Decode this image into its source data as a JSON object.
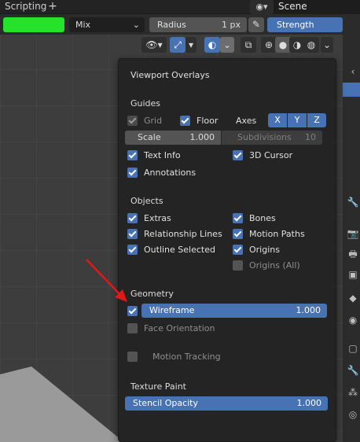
{
  "topbar": {
    "workspace_tab": "Scripting",
    "add_tab": "+",
    "scene_label": "Scene"
  },
  "toolbar": {
    "color": "#26e22a",
    "blend_mode": "Mix",
    "radius_label": "Radius",
    "radius_value": "1 px",
    "strength_label": "Strength"
  },
  "popover": {
    "title": "Viewport Overlays",
    "guides": {
      "title": "Guides",
      "grid": {
        "label": "Grid",
        "checked": true,
        "enabled": false
      },
      "floor": {
        "label": "Floor",
        "checked": true
      },
      "axes_label": "Axes",
      "axes": [
        "X",
        "Y",
        "Z"
      ],
      "scale_label": "Scale",
      "scale_value": "1.000",
      "subdivisions_label": "Subdivisions",
      "subdivisions_value": "10",
      "text_info": {
        "label": "Text Info",
        "checked": true
      },
      "cursor_3d": {
        "label": "3D Cursor",
        "checked": true
      },
      "annotations": {
        "label": "Annotations",
        "checked": true
      }
    },
    "objects": {
      "title": "Objects",
      "extras": {
        "label": "Extras",
        "checked": true
      },
      "bones": {
        "label": "Bones",
        "checked": true
      },
      "relationship_lines": {
        "label": "Relationship Lines",
        "checked": true
      },
      "motion_paths": {
        "label": "Motion Paths",
        "checked": true
      },
      "outline_selected": {
        "label": "Outline Selected",
        "checked": true
      },
      "origins": {
        "label": "Origins",
        "checked": true
      },
      "origins_all": {
        "label": "Origins (All)",
        "checked": false
      }
    },
    "geometry": {
      "title": "Geometry",
      "wireframe_label": "Wireframe",
      "wireframe_value": "1.000",
      "wireframe_checked": true,
      "face_orientation": {
        "label": "Face Orientation",
        "checked": false
      }
    },
    "motion_tracking": {
      "label": "Motion Tracking",
      "checked": false
    },
    "texture_paint": {
      "title": "Texture Paint",
      "stencil_label": "Stencil Opacity",
      "stencil_value": "1.000"
    }
  },
  "colors": {
    "accent": "#4772b3",
    "panel_bg": "#242424",
    "annotation_arrow": "#e01818"
  }
}
